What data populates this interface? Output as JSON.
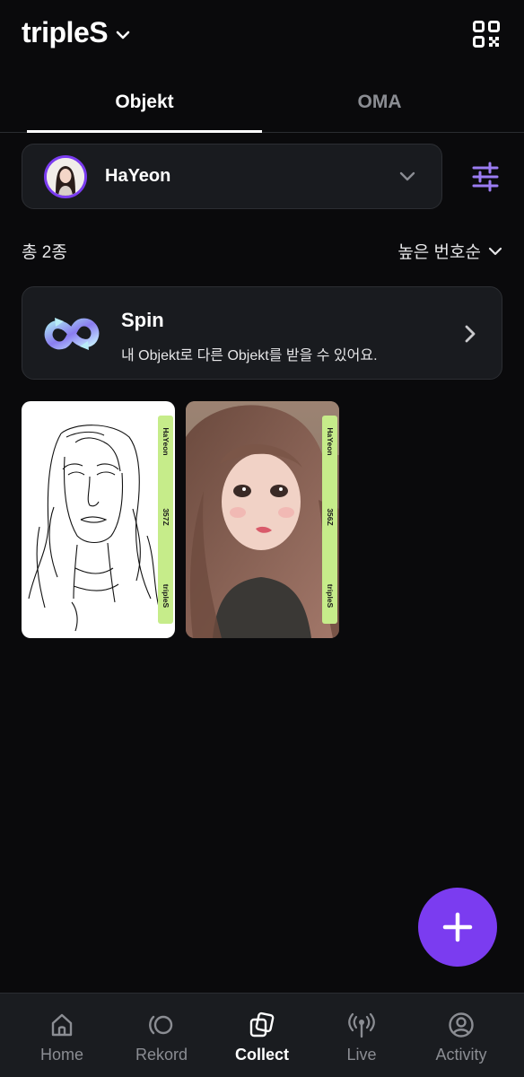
{
  "header": {
    "title": "tripleS",
    "title_chevron_icon": "chevron-down-icon",
    "qr_icon": "qr-code-icon"
  },
  "tabs": [
    {
      "label": "Objekt",
      "active": true
    },
    {
      "label": "OMA",
      "active": false
    }
  ],
  "member_select": {
    "name": "HaYeon",
    "avatar_icon": "member-avatar",
    "chevron_icon": "chevron-down-icon"
  },
  "filter_icon": "sliders-filter-icon",
  "summary": {
    "total": "총 2종",
    "sort_label": "높은 번호순"
  },
  "spin": {
    "title": "Spin",
    "description": "내 Objekt로 다른 Objekt를 받을 수 있어요.",
    "icon": "spin-loop-icon"
  },
  "objekts": [
    {
      "member": "HaYeon",
      "serial": "357Z",
      "group": "tripleS",
      "style": "sketch"
    },
    {
      "member": "HaYeon",
      "serial": "356Z",
      "group": "tripleS",
      "style": "photo"
    }
  ],
  "fab_icon": "plus-icon",
  "nav": [
    {
      "label": "Home",
      "icon": "home-icon",
      "active": false
    },
    {
      "label": "Rekord",
      "icon": "rekord-icon",
      "active": false
    },
    {
      "label": "Collect",
      "icon": "collect-icon",
      "active": true
    },
    {
      "label": "Live",
      "icon": "live-broadcast-icon",
      "active": false
    },
    {
      "label": "Activity",
      "icon": "profile-icon",
      "active": false
    }
  ],
  "colors": {
    "background": "#0a0a0c",
    "accent": "#7b3cf0",
    "card": "#191b1f",
    "strip": "#c6ec8a",
    "muted": "#8b8d93"
  }
}
